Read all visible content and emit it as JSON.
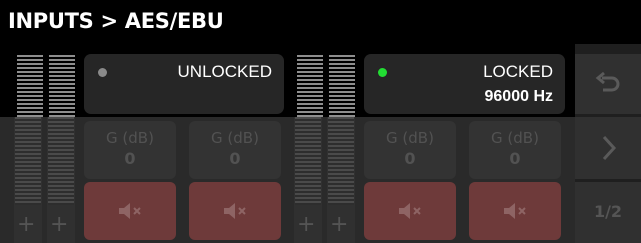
{
  "header": {
    "title": "INPUTS > AES/EBU"
  },
  "channels": [
    {
      "status": "UNLOCKED",
      "indicator_color": "#8a8a8a",
      "sample_rate": ""
    },
    {
      "status": "LOCKED",
      "indicator_color": "#22dd33",
      "sample_rate": "96000 Hz"
    }
  ],
  "gains": [
    {
      "label": "G (dB)",
      "value": "0"
    },
    {
      "label": "G (dB)",
      "value": "0"
    },
    {
      "label": "G (dB)",
      "value": "0"
    },
    {
      "label": "G (dB)",
      "value": "0"
    }
  ],
  "meters": {
    "add_label": "+"
  },
  "mute_buttons": [
    {
      "icon": "speaker-muted-icon"
    },
    {
      "icon": "speaker-muted-icon"
    },
    {
      "icon": "speaker-muted-icon"
    },
    {
      "icon": "speaker-muted-icon"
    }
  ],
  "navigation": {
    "back_icon": "undo-icon",
    "next_icon": "chevron-right-icon",
    "page": "1/2"
  },
  "colors": {
    "locked": "#22dd33",
    "unlocked": "#8a8a8a",
    "mute_background": "#6e3a3a"
  }
}
